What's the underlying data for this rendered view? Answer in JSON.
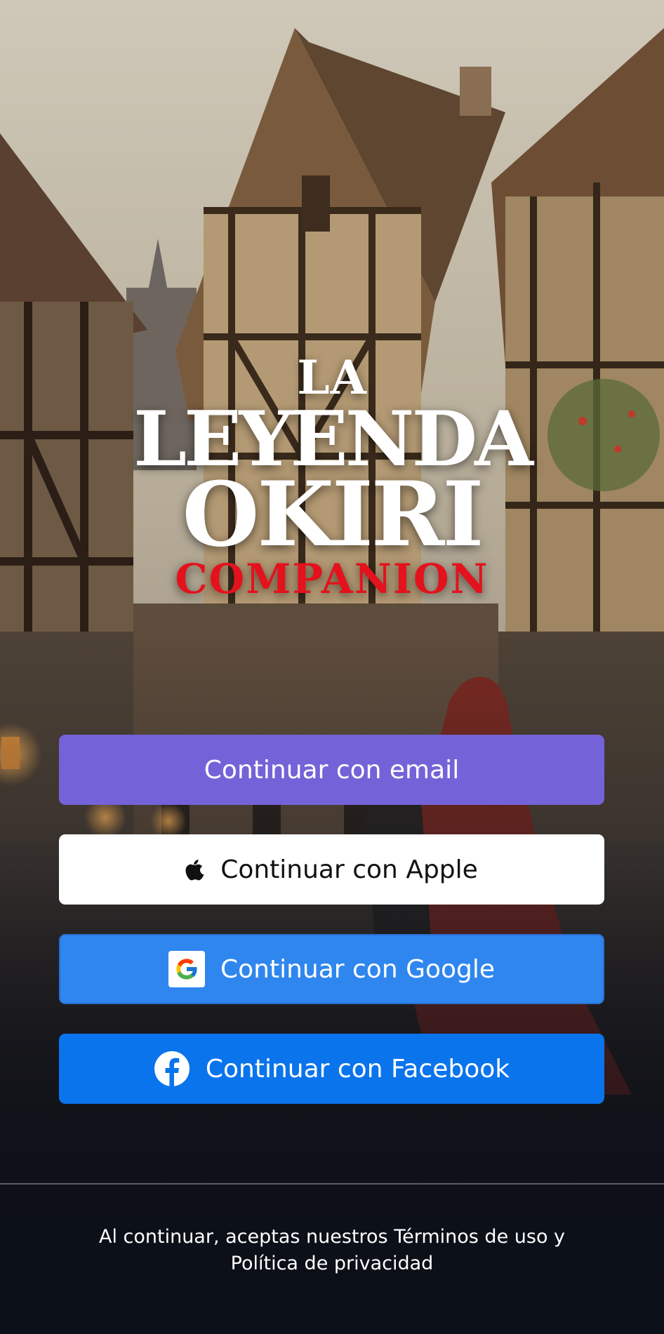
{
  "logo": {
    "line1": "LA",
    "line2": "LEYENDA",
    "line3": "OKIRI",
    "line4": "COMPANION"
  },
  "buttons": {
    "email": {
      "label": "Continuar con email",
      "color": "#7463d8"
    },
    "apple": {
      "label": "Continuar con Apple",
      "icon": "apple-icon",
      "color": "#ffffff"
    },
    "google": {
      "label": "Continuar con Google",
      "icon": "google-icon",
      "color": "#2f86ef"
    },
    "facebook": {
      "label": "Continuar con Facebook",
      "icon": "facebook-icon",
      "color": "#0a74ec"
    }
  },
  "legal": {
    "line1": "Al continuar, aceptas nuestros Términos de uso y",
    "line2": "Política de privacidad"
  }
}
